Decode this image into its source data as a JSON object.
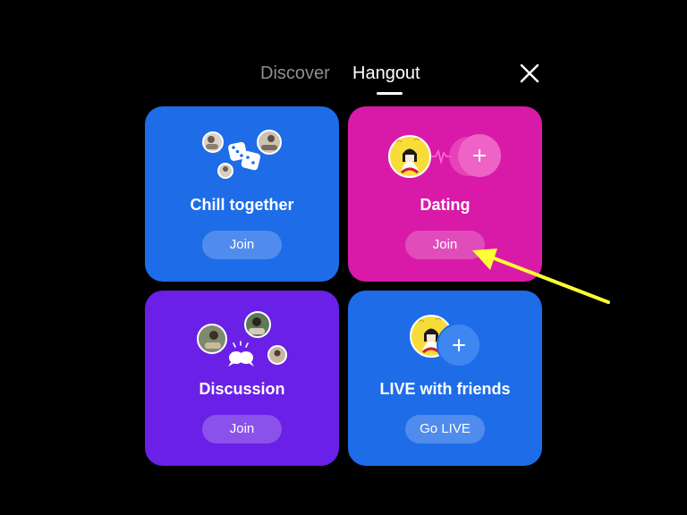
{
  "tabs": {
    "discover": "Discover",
    "hangout": "Hangout",
    "active": "hangout"
  },
  "close_icon": "close-icon",
  "cards": {
    "chill": {
      "title": "Chill together",
      "button": "Join",
      "color": "#1e6ce8"
    },
    "dating": {
      "title": "Dating",
      "button": "Join",
      "color": "#d91aa8"
    },
    "discussion": {
      "title": "Discussion",
      "button": "Join",
      "color": "#6a20e6"
    },
    "live": {
      "title": "LIVE with friends",
      "button": "Go LIVE",
      "color": "#1e6ce8"
    }
  },
  "annotation": {
    "color": "#ffff33"
  }
}
